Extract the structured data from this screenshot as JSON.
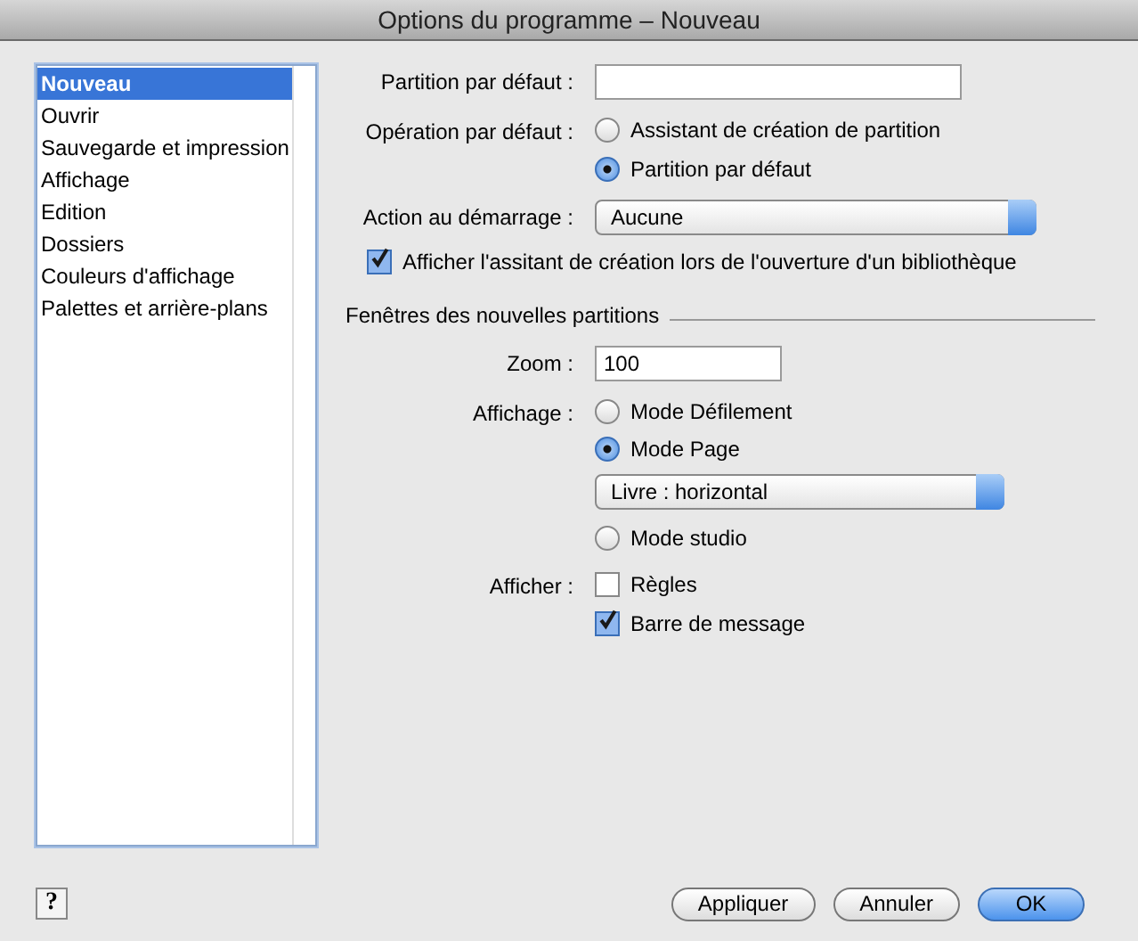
{
  "window": {
    "title": "Options du programme – Nouveau"
  },
  "sidebar": {
    "items": [
      {
        "label": "Nouveau",
        "selected": true
      },
      {
        "label": "Ouvrir",
        "selected": false
      },
      {
        "label": "Sauvegarde et impression",
        "selected": false
      },
      {
        "label": "Affichage",
        "selected": false
      },
      {
        "label": "Edition",
        "selected": false
      },
      {
        "label": "Dossiers",
        "selected": false
      },
      {
        "label": "Couleurs d'affichage",
        "selected": false
      },
      {
        "label": "Palettes et arrière-plans",
        "selected": false
      }
    ]
  },
  "default_score": {
    "label": "Partition par défaut :"
  },
  "default_operation": {
    "label": "Opération par défaut :",
    "options": [
      {
        "label": "Assistant de création de partition",
        "selected": false
      },
      {
        "label": "Partition par défaut",
        "selected": true
      }
    ]
  },
  "startup_action": {
    "label": "Action au démarrage :",
    "value": "Aucune"
  },
  "show_assistant": {
    "label": "Afficher l'assitant de création lors de l'ouverture d'un bibliothèque",
    "checked": true
  },
  "new_windows": {
    "title": "Fenêtres des nouvelles partitions",
    "zoom": {
      "label": "Zoom :",
      "value": "100"
    },
    "display": {
      "label": "Affichage :",
      "options": [
        {
          "label": "Mode Défilement",
          "selected": false
        },
        {
          "label": "Mode Page",
          "selected": true,
          "dropdown": "Livre : horizontal"
        },
        {
          "label": "Mode studio",
          "selected": false
        }
      ]
    },
    "show": {
      "label": "Afficher :",
      "options": [
        {
          "label": "Règles",
          "checked": false
        },
        {
          "label": "Barre de message",
          "checked": true
        }
      ]
    }
  },
  "help_button": "?",
  "buttons": [
    {
      "label": "Appliquer",
      "default": false
    },
    {
      "label": "Annuler",
      "default": false
    },
    {
      "label": "OK",
      "default": true
    }
  ]
}
